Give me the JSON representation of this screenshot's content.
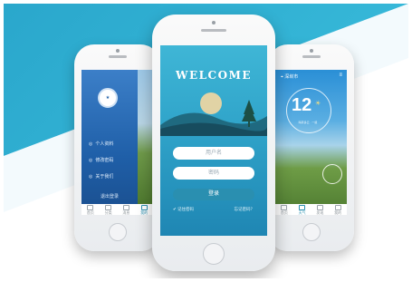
{
  "left_phone": {
    "menu": [
      "个人资料",
      "修改密码",
      "关于我们"
    ],
    "logout": "退出登录",
    "tabs": [
      "首页",
      "分类",
      "消息",
      "我的"
    ]
  },
  "center_phone": {
    "welcome": "WELCOME",
    "username_placeholder": "用户名",
    "password_placeholder": "密码",
    "login_button": "登录",
    "remember": "记住密码",
    "forgot": "忘记密码？"
  },
  "right_phone": {
    "city": "深圳市",
    "temperature": "12",
    "condition": "晴转多云 · 一级",
    "tabs": [
      "首页",
      "天气",
      "发现",
      "我的"
    ]
  },
  "colors": {
    "background": "#35b6d7",
    "login_button": "#2a8fb0",
    "left_screen": "#1f5fa8"
  }
}
